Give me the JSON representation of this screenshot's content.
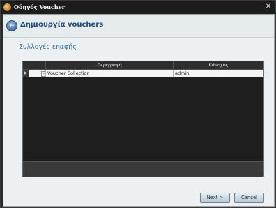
{
  "window": {
    "title": "Οδηγός Voucher",
    "close_glyph": "✕"
  },
  "header": {
    "title": "Δημιουργία vouchers",
    "back_glyph": "←"
  },
  "section": {
    "title": "Συλλογές επαφής"
  },
  "grid": {
    "columns": [
      "",
      "",
      "Περιγραφή",
      "Κάτοχος"
    ],
    "rows": [
      {
        "indicator": "▶",
        "checked": true,
        "description": "Voucher Collection",
        "owner": "admin"
      }
    ]
  },
  "buttons": {
    "next": "Next >",
    "cancel": "Cancel"
  }
}
